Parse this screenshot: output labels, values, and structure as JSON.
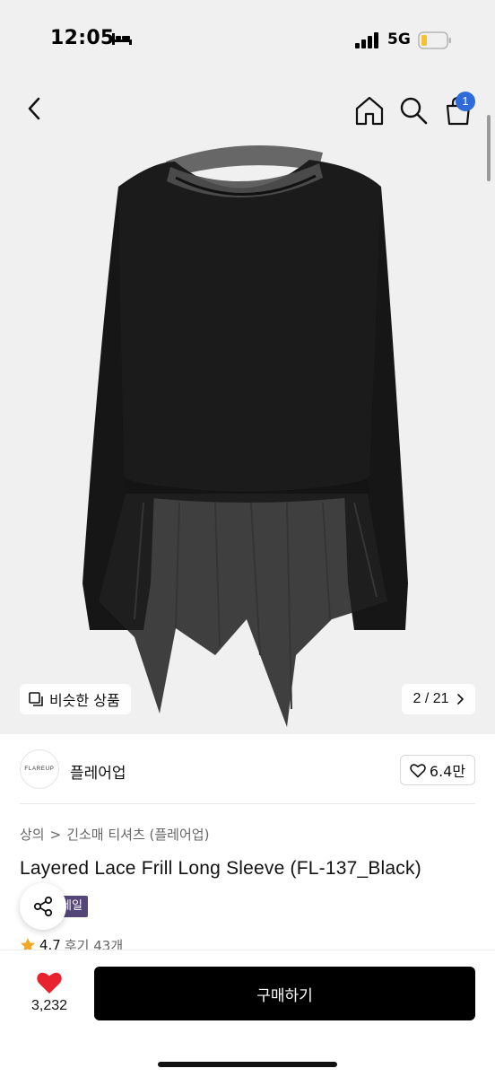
{
  "status_bar": {
    "time": "12:05",
    "network": "5G",
    "sleep_icon": "bed-icon",
    "signal_icon": "cellular-signal-icon",
    "battery_icon": "battery-low-icon"
  },
  "header": {
    "back_icon": "chevron-left-icon",
    "home_icon": "home-icon",
    "search_icon": "search-icon",
    "cart_icon": "shopping-bag-icon",
    "cart_badge": "1"
  },
  "gallery": {
    "similar_label": "비슷한 상품",
    "similar_icon": "duplicate-icon",
    "page_counter": "2 / 21",
    "counter_icon": "chevron-right-icon"
  },
  "brand": {
    "logo_text": "FLAREUP",
    "name": "플레어업",
    "like_count": "6.4만",
    "like_icon": "heart-outline-icon"
  },
  "breadcrumb": {
    "category": "상의",
    "separator": ">",
    "subcategory": "긴소매 티셔츠 (플레어업)"
  },
  "product": {
    "title": "Layered Lace Frill Long Sleeve (FL-137_Black)",
    "sale_badge": "세일"
  },
  "rating": {
    "score": "4.7",
    "reviews": "후기 43개",
    "star_icon": "star-icon"
  },
  "share": {
    "icon": "share-icon"
  },
  "bottom_bar": {
    "wish_icon": "heart-filled-icon",
    "wish_count": "3,232",
    "buy_label": "구매하기"
  },
  "colors": {
    "brand_badge": "#55467a",
    "cart_badge": "#2f6bd8",
    "heart": "#e8222f",
    "star": "#f5a623",
    "buy_button": "#000000"
  }
}
